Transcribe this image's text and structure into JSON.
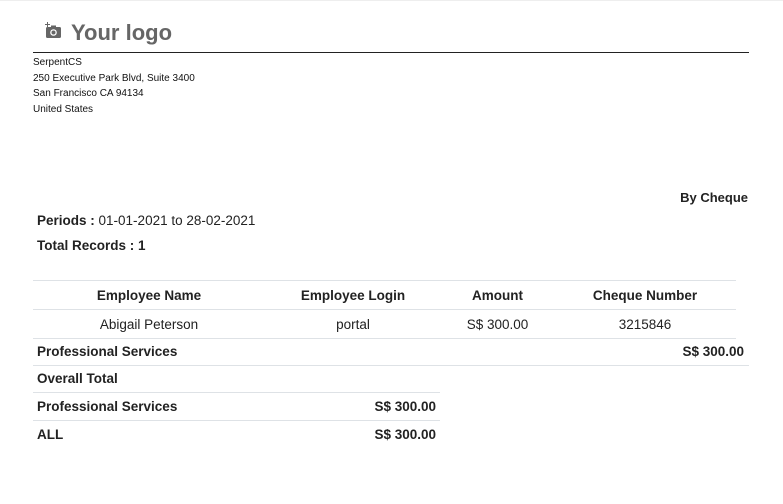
{
  "logo": {
    "text": "Your logo",
    "icon": "camera-icon"
  },
  "company": {
    "name": "SerpentCS",
    "street": "250 Executive Park Blvd, Suite 3400",
    "city": "San Francisco CA 94134",
    "country": "United States"
  },
  "payment_method": "By Cheque",
  "periods": {
    "label": "Periods :",
    "value": "01-01-2021 to 28-02-2021"
  },
  "total_records": {
    "label": "Total Records :",
    "value": "1"
  },
  "employee_table": {
    "headers": [
      "Employee Name",
      "Employee Login",
      "Amount",
      "Cheque Number"
    ],
    "rows": [
      [
        "Abigail Peterson",
        "portal",
        "S$ 300.00",
        "3215846"
      ]
    ]
  },
  "group_total": {
    "label": "Professional Services",
    "amount": "S$ 300.00"
  },
  "overall": {
    "title": "Overall Total",
    "rows": [
      {
        "label": "Professional Services",
        "amount": "S$ 300.00"
      },
      {
        "label": "ALL",
        "amount": "S$ 300.00"
      }
    ]
  }
}
